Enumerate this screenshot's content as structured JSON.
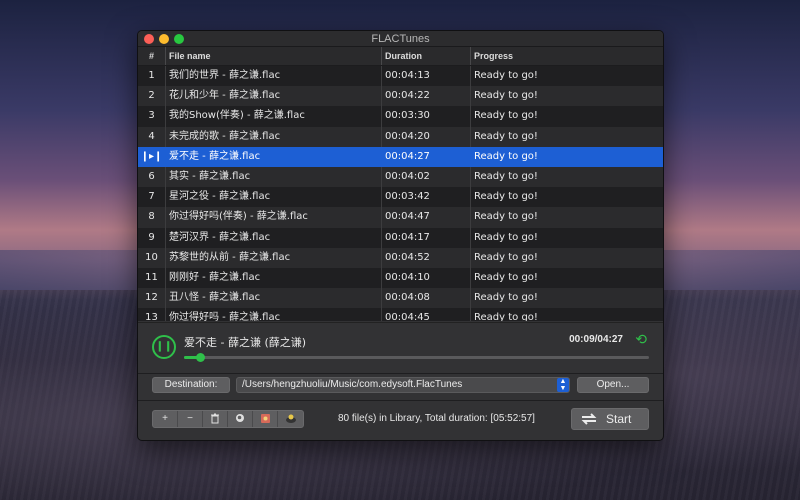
{
  "window": {
    "title": "FLACTunes"
  },
  "table": {
    "headers": {
      "num": "#",
      "name": "File name",
      "duration": "Duration",
      "progress": "Progress"
    },
    "rows": [
      {
        "num": "1",
        "name": "我们的世界 - 薛之谦.flac",
        "duration": "00:04:13",
        "progress": "Ready to go!"
      },
      {
        "num": "2",
        "name": "花儿和少年 - 薛之谦.flac",
        "duration": "00:04:22",
        "progress": "Ready to go!"
      },
      {
        "num": "3",
        "name": "我的Show(伴奏) - 薛之谦.flac",
        "duration": "00:03:30",
        "progress": "Ready to go!"
      },
      {
        "num": "4",
        "name": "未完成的歌 - 薛之谦.flac",
        "duration": "00:04:20",
        "progress": "Ready to go!"
      },
      {
        "num": "❙▸❙",
        "name": "爱不走 - 薛之谦.flac",
        "duration": "00:04:27",
        "progress": "Ready to go!",
        "selected": true
      },
      {
        "num": "6",
        "name": "其实 - 薛之谦.flac",
        "duration": "00:04:02",
        "progress": "Ready to go!"
      },
      {
        "num": "7",
        "name": "星河之役 - 薛之谦.flac",
        "duration": "00:03:42",
        "progress": "Ready to go!"
      },
      {
        "num": "8",
        "name": "你过得好吗(伴奏) - 薛之谦.flac",
        "duration": "00:04:47",
        "progress": "Ready to go!"
      },
      {
        "num": "9",
        "name": "楚河汉界 - 薛之谦.flac",
        "duration": "00:04:17",
        "progress": "Ready to go!"
      },
      {
        "num": "10",
        "name": "苏黎世的从前 - 薛之谦.flac",
        "duration": "00:04:52",
        "progress": "Ready to go!"
      },
      {
        "num": "11",
        "name": "刚刚好 - 薛之谦.flac",
        "duration": "00:04:10",
        "progress": "Ready to go!"
      },
      {
        "num": "12",
        "name": "丑八怪 - 薛之谦.flac",
        "duration": "00:04:08",
        "progress": "Ready to go!"
      },
      {
        "num": "13",
        "name": "你过得好吗 - 薛之谦.flac",
        "duration": "00:04:45",
        "progress": "Ready to go!"
      }
    ]
  },
  "player": {
    "now_playing": "爱不走 - 薛之谦 (薛之谦)",
    "time": "00:09/04:27",
    "progress_fraction": 0.034,
    "pause_glyph": "❙❙",
    "repeat_glyph": "⟲"
  },
  "destination": {
    "label": "Destination:",
    "path": "/Users/hengzhuoliu/Music/com.edysoft.FlacTunes",
    "open_label": "Open..."
  },
  "toolbar": {
    "add": "+",
    "remove": "−",
    "library_info": "80 file(s) in Library, Total duration: [05:52:57]",
    "start_label": "Start"
  },
  "colors": {
    "accent_green": "#2fc04a",
    "selection_blue": "#1d5fd4"
  }
}
